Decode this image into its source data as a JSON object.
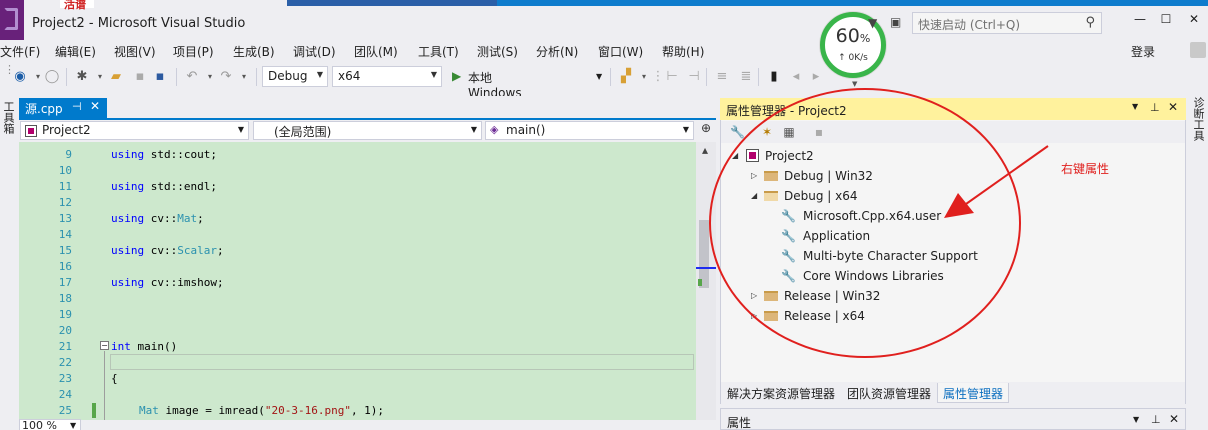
{
  "window": {
    "title": "Project2 - Microsoft Visual Studio",
    "badge_text": "活谱",
    "quick_launch_placeholder": "快速启动 (Ctrl+Q)",
    "minimize": "—",
    "maximize": "☐",
    "close": "✕"
  },
  "network_widget": {
    "percent": "60",
    "percent_unit": "%",
    "speed": "↑ 0K/s",
    "ring_color": "#39b54a"
  },
  "menu": {
    "items": [
      "文件(F)",
      "编辑(E)",
      "视图(V)",
      "项目(P)",
      "生成(B)",
      "调试(D)",
      "团队(M)",
      "工具(T)",
      "测试(S)",
      "分析(N)",
      "窗口(W)",
      "帮助(H)"
    ],
    "login": "登录"
  },
  "toolbar": {
    "config": "Debug",
    "platform": "x64",
    "run_label": "本地 Windows 调试器"
  },
  "editor": {
    "tab_label": "源.cpp",
    "tab_pin": "⊣",
    "tab_close": "✕",
    "toolbox_label": "工具箱",
    "nav_project": "Project2",
    "nav_scope": "(全局范围)",
    "nav_member": "main()",
    "zoom": "100 %",
    "lines": [
      {
        "n": "9",
        "code": "using std::cout;"
      },
      {
        "n": "10",
        "code": ""
      },
      {
        "n": "11",
        "code": "using std::endl;"
      },
      {
        "n": "12",
        "code": ""
      },
      {
        "n": "13",
        "code": "using cv::Mat;"
      },
      {
        "n": "14",
        "code": ""
      },
      {
        "n": "15",
        "code": "using cv::Scalar;"
      },
      {
        "n": "16",
        "code": ""
      },
      {
        "n": "17",
        "code": "using cv::imshow;"
      },
      {
        "n": "18",
        "code": ""
      },
      {
        "n": "19",
        "code": ""
      },
      {
        "n": "20",
        "code": ""
      },
      {
        "n": "21",
        "code": "int main()"
      },
      {
        "n": "22",
        "code": ""
      },
      {
        "n": "23",
        "code": "{"
      },
      {
        "n": "24",
        "code": ""
      },
      {
        "n": "25",
        "code": "Mat image = imread(\"20-3-16.png\", 1);"
      }
    ],
    "code_bg": "#cde8cd"
  },
  "property_manager": {
    "title": "属性管理器 - Project2",
    "tree": {
      "project": "Project2",
      "debug_win32": "Debug | Win32",
      "debug_x64": "Debug | x64",
      "sheets": [
        "Microsoft.Cpp.x64.user",
        "Application",
        "Multi-byte Character Support",
        "Core Windows Libraries"
      ],
      "release_win32": "Release | Win32",
      "release_x64": "Release | x64"
    },
    "bottom_tabs": [
      "解决方案资源管理器",
      "团队资源管理器",
      "属性管理器"
    ],
    "header_color": "#fff29d"
  },
  "properties": {
    "title": "属性"
  },
  "diagnostics": {
    "label": "诊断工具"
  },
  "annotation": {
    "text": "右键属性",
    "color": "#e0201e"
  }
}
